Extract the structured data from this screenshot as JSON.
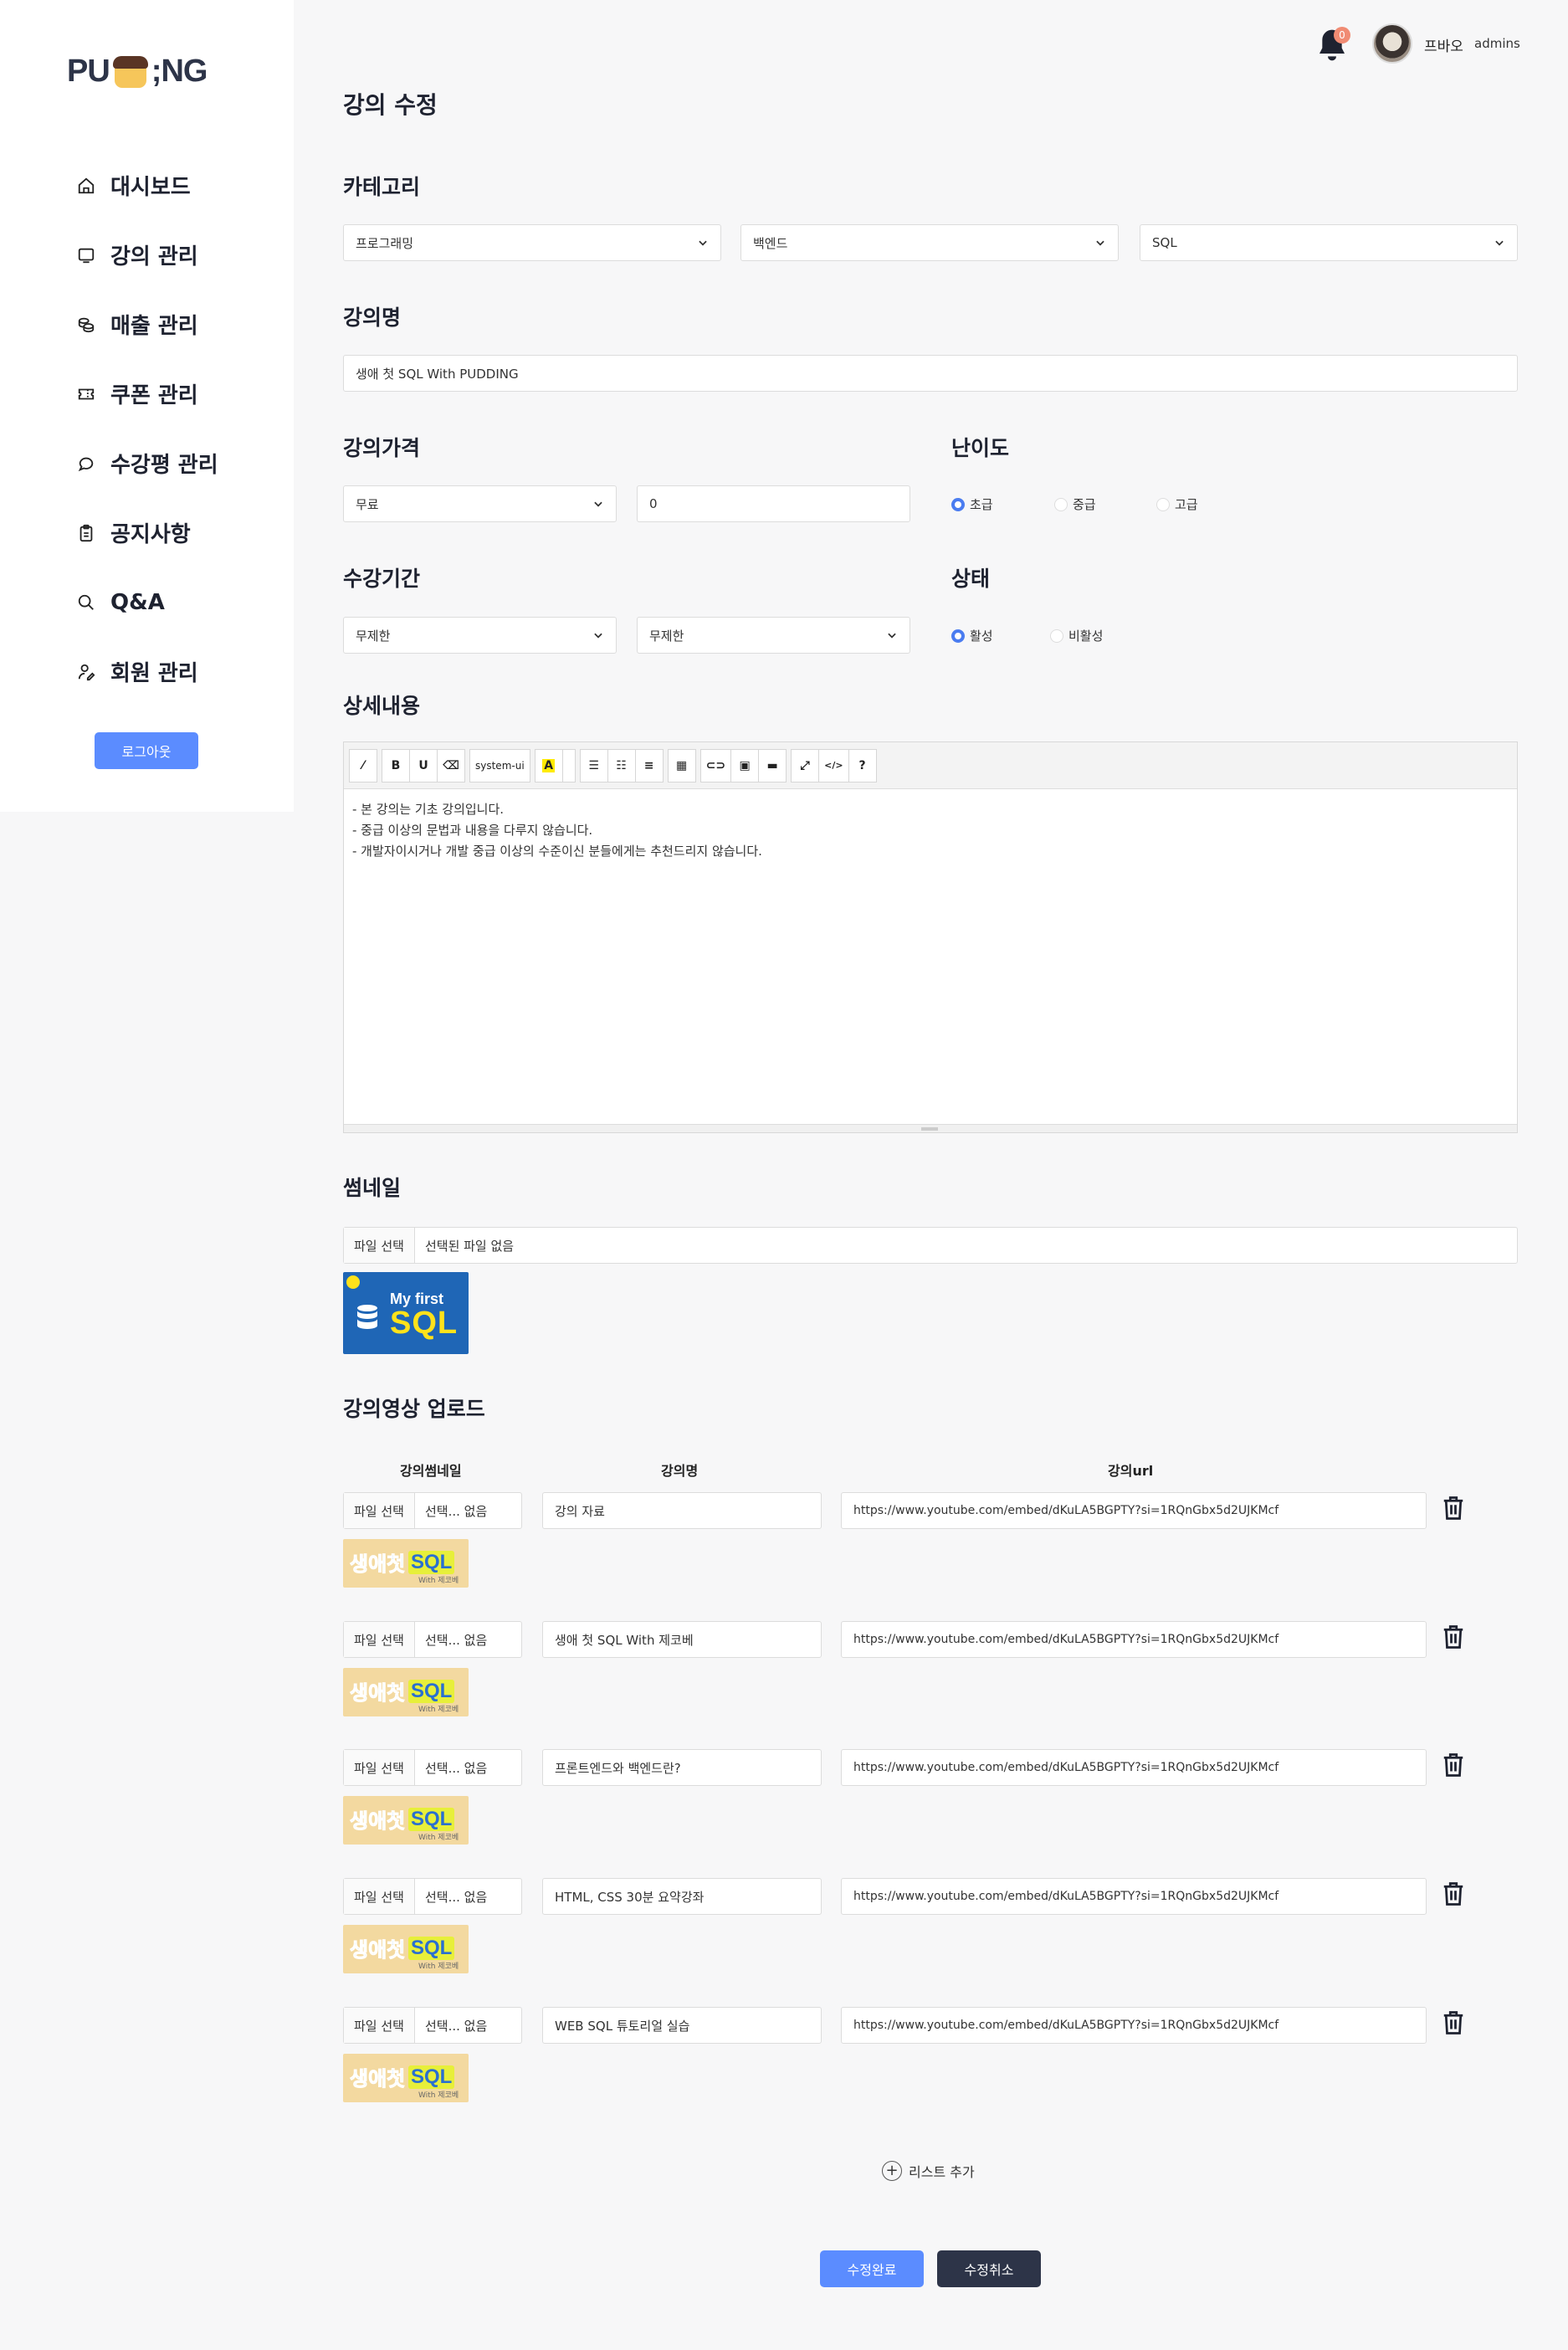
{
  "brand": {
    "logo_left": "PU",
    "logo_right": ";NG"
  },
  "sidebar": {
    "items": [
      {
        "label": "대시보드",
        "icon": "home-icon"
      },
      {
        "label": "강의 관리",
        "icon": "monitor-icon"
      },
      {
        "label": "매출 관리",
        "icon": "coins-icon"
      },
      {
        "label": "쿠폰 관리",
        "icon": "ticket-icon"
      },
      {
        "label": "수강평 관리",
        "icon": "chat-icon"
      },
      {
        "label": "공지사항",
        "icon": "clipboard-icon"
      },
      {
        "label": "Q&A",
        "icon": "search-icon"
      },
      {
        "label": "회원 관리",
        "icon": "user-edit-icon"
      }
    ],
    "logout_label": "로그아웃"
  },
  "header": {
    "notification_count": "0",
    "user_name": "프바오",
    "user_role": "admins"
  },
  "page": {
    "title": "강의 수정",
    "category": {
      "title": "카테고리",
      "values": [
        "프로그래밍",
        "백엔드",
        "SQL"
      ]
    },
    "course_name": {
      "title": "강의명",
      "value": "생애 첫 SQL With PUDDING"
    },
    "price": {
      "title": "강의가격",
      "type": "무료",
      "amount": "0"
    },
    "difficulty": {
      "title": "난이도",
      "options": [
        "초급",
        "중급",
        "고급"
      ],
      "selected": "초급"
    },
    "period": {
      "title": "수강기간",
      "start": "무제한",
      "end": "무제한"
    },
    "status": {
      "title": "상태",
      "options": [
        "활성",
        "비활성"
      ],
      "selected": "활성"
    },
    "detail": {
      "title": "상세내용",
      "toolbar": {
        "font": "system-ui",
        "help": "?"
      },
      "lines": [
        "- 본 강의는 기초 강의입니다.",
        "- 중급 이상의 문법과 내용을 다루지 않습니다.",
        "- 개발자이시거나 개발 중급 이상의 수준이신 분들에게는 추천드리지 않습니다."
      ]
    },
    "thumbnail": {
      "title": "썸네일",
      "file_button": "파일 선택",
      "file_status": "선택된 파일 없음",
      "image_text_1": "My first",
      "image_text_2": "SQL"
    },
    "videos": {
      "title": "강의영상 업로드",
      "headers": {
        "thumb": "강의썸네일",
        "name": "강의명",
        "url": "강의url"
      },
      "file_button": "파일 선택",
      "file_status": "선택... 없음",
      "thumb_text_kr": "생애첫",
      "thumb_text_sql": "SQL",
      "thumb_text_with": "With 제코베",
      "rows": [
        {
          "name": "강의 자료",
          "url": "https://www.youtube.com/embed/dKuLA5BGPTY?si=1RQnGbx5d2UJKMcf"
        },
        {
          "name": "생애 첫 SQL With 제코베",
          "url": "https://www.youtube.com/embed/dKuLA5BGPTY?si=1RQnGbx5d2UJKMcf"
        },
        {
          "name": "프론트엔드와 백엔드란?",
          "url": "https://www.youtube.com/embed/dKuLA5BGPTY?si=1RQnGbx5d2UJKMcf"
        },
        {
          "name": "HTML, CSS 30분 요약강좌",
          "url": "https://www.youtube.com/embed/dKuLA5BGPTY?si=1RQnGbx5d2UJKMcf"
        },
        {
          "name": "WEB SQL 튜토리얼 실습",
          "url": "https://www.youtube.com/embed/dKuLA5BGPTY?si=1RQnGbx5d2UJKMcf"
        }
      ],
      "add_label": "리스트 추가"
    },
    "actions": {
      "save": "수정완료",
      "cancel": "수정취소"
    }
  },
  "colors": {
    "primary": "#5b8cff",
    "dark": "#2d3448",
    "radio_on": "#4a7cf0",
    "badge": "#f08b73"
  }
}
